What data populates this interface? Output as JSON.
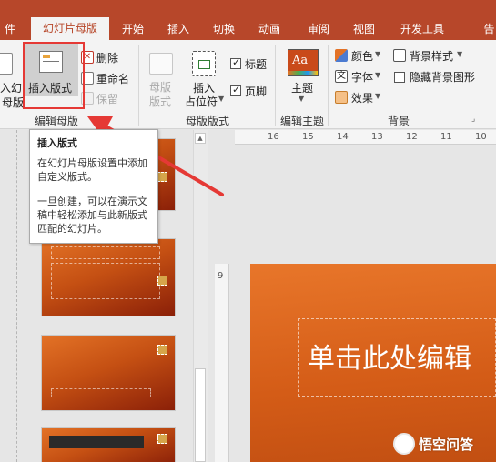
{
  "tabs": [
    {
      "label": "件",
      "active": false
    },
    {
      "label": "幻灯片母版",
      "active": true
    },
    {
      "label": "开始",
      "active": false
    },
    {
      "label": "插入",
      "active": false
    },
    {
      "label": "切换",
      "active": false
    },
    {
      "label": "动画",
      "active": false
    },
    {
      "label": "审阅",
      "active": false
    },
    {
      "label": "视图",
      "active": false
    },
    {
      "label": "开发工具",
      "active": false
    },
    {
      "label": "告",
      "active": false
    }
  ],
  "ribbon": {
    "edit_master": {
      "insert_master_label_1": "入幻",
      "insert_master_label_2": "母版",
      "insert_layout_label": "插入版式",
      "delete_label": "删除",
      "rename_label": "重命名",
      "preserve_label": "保留",
      "group_label": "编辑母版"
    },
    "master_layout": {
      "master_layout_label_1": "母版",
      "master_layout_label_2": "版式",
      "insert_placeholder_label_1": "插入",
      "insert_placeholder_label_2": "占位符",
      "title_checkbox_label": "标题",
      "footer_checkbox_label": "页脚",
      "title_checked": true,
      "footer_checked": true,
      "group_label": "母版版式"
    },
    "edit_theme": {
      "theme_label": "主题",
      "group_label": "编辑主题"
    },
    "background": {
      "colors_label": "颜色",
      "fonts_label": "字体",
      "effects_label": "效果",
      "background_styles_label": "背景样式",
      "hide_background_label": "隐藏背景图形",
      "group_label": "背景"
    }
  },
  "tooltip": {
    "title": "插入版式",
    "body1": "在幻灯片母版设置中添加自定义版式。",
    "body2": "一旦创建，可以在演示文稿中轻松添加与此新版式匹配的幻灯片。"
  },
  "hruler_labels": [
    "16",
    "15",
    "14",
    "13",
    "12",
    "11",
    "10"
  ],
  "vruler_label": "9",
  "slide": {
    "title_text": "单击此处编辑"
  },
  "watermark": {
    "text": "悟空问答"
  },
  "colors": {
    "accent": "#b7472a",
    "highlight": "#e53935",
    "slide_orange": "#d45c17"
  }
}
